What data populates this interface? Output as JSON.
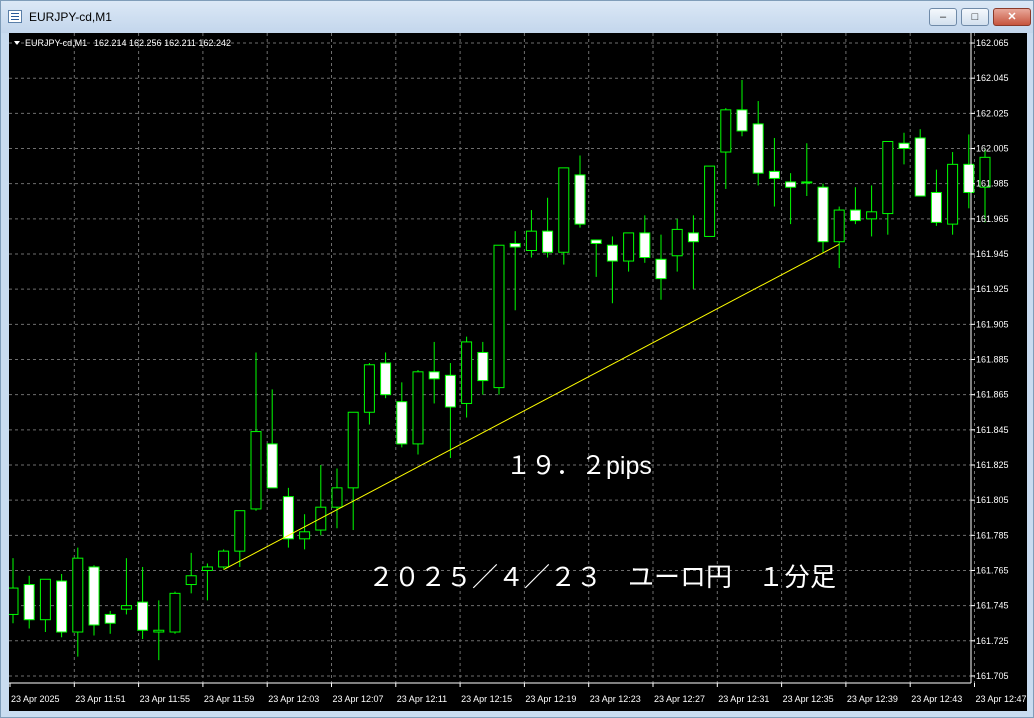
{
  "window": {
    "title": "EURJPY-cd,M1"
  },
  "controls": {
    "minimize": "–",
    "maximize": "□",
    "close": "✕"
  },
  "chart_header": {
    "symbol": "EURJPY-cd,M1",
    "ohlc": "162.214 162.256 162.211 162.242"
  },
  "annotations": {
    "pips": "１９．２pips",
    "caption": "２０２５／４／２３　ユーロ円　１分足"
  },
  "colors": {
    "background": "#000000",
    "grid": "#6e6e6e",
    "bull_body": "#000000",
    "bear_body": "#ffffff",
    "wick": "#00ff00",
    "trendline": "#ffff00",
    "text": "#ffffff"
  },
  "chart_data": {
    "type": "candlestick",
    "y_ticks": [
      "162.065",
      "162.045",
      "162.025",
      "162.005",
      "161.985",
      "161.965",
      "161.945",
      "161.925",
      "161.905",
      "161.885",
      "161.865",
      "161.845",
      "161.825",
      "161.805",
      "161.785",
      "161.765",
      "161.745",
      "161.725",
      "161.705"
    ],
    "ylim": [
      161.701,
      162.069
    ],
    "x_ticks": [
      "23 Apr 2025",
      "23 Apr 11:51",
      "23 Apr 11:55",
      "23 Apr 11:59",
      "23 Apr 12:03",
      "23 Apr 12:07",
      "23 Apr 12:11",
      "23 Apr 12:15",
      "23 Apr 12:19",
      "23 Apr 12:23",
      "23 Apr 12:27",
      "23 Apr 12:31",
      "23 Apr 12:35",
      "23 Apr 12:39",
      "23 Apr 12:43",
      "23 Apr 12:47"
    ],
    "grid": true,
    "candles": [
      {
        "o": 161.74,
        "h": 161.772,
        "l": 161.735,
        "c": 161.755
      },
      {
        "o": 161.757,
        "h": 161.762,
        "l": 161.732,
        "c": 161.737
      },
      {
        "o": 161.737,
        "h": 161.76,
        "l": 161.73,
        "c": 161.76
      },
      {
        "o": 161.759,
        "h": 161.763,
        "l": 161.727,
        "c": 161.73
      },
      {
        "o": 161.73,
        "h": 161.778,
        "l": 161.716,
        "c": 161.772
      },
      {
        "o": 161.767,
        "h": 161.768,
        "l": 161.728,
        "c": 161.734
      },
      {
        "o": 161.74,
        "h": 161.742,
        "l": 161.729,
        "c": 161.735
      },
      {
        "o": 161.743,
        "h": 161.772,
        "l": 161.74,
        "c": 161.745
      },
      {
        "o": 161.747,
        "h": 161.767,
        "l": 161.726,
        "c": 161.731
      },
      {
        "o": 161.73,
        "h": 161.748,
        "l": 161.714,
        "c": 161.731
      },
      {
        "o": 161.73,
        "h": 161.753,
        "l": 161.729,
        "c": 161.752
      },
      {
        "o": 161.757,
        "h": 161.775,
        "l": 161.752,
        "c": 161.762
      },
      {
        "o": 161.765,
        "h": 161.769,
        "l": 161.748,
        "c": 161.767
      },
      {
        "o": 161.767,
        "h": 161.777,
        "l": 161.766,
        "c": 161.776
      },
      {
        "o": 161.776,
        "h": 161.799,
        "l": 161.767,
        "c": 161.799
      },
      {
        "o": 161.8,
        "h": 161.889,
        "l": 161.799,
        "c": 161.844
      },
      {
        "o": 161.837,
        "h": 161.868,
        "l": 161.812,
        "c": 161.812
      },
      {
        "o": 161.807,
        "h": 161.812,
        "l": 161.778,
        "c": 161.783
      },
      {
        "o": 161.783,
        "h": 161.797,
        "l": 161.777,
        "c": 161.787
      },
      {
        "o": 161.788,
        "h": 161.825,
        "l": 161.785,
        "c": 161.801
      },
      {
        "o": 161.801,
        "h": 161.823,
        "l": 161.789,
        "c": 161.812
      },
      {
        "o": 161.812,
        "h": 161.85,
        "l": 161.788,
        "c": 161.855
      },
      {
        "o": 161.855,
        "h": 161.883,
        "l": 161.848,
        "c": 161.882
      },
      {
        "o": 161.883,
        "h": 161.889,
        "l": 161.863,
        "c": 161.865
      },
      {
        "o": 161.861,
        "h": 161.872,
        "l": 161.835,
        "c": 161.837
      },
      {
        "o": 161.837,
        "h": 161.879,
        "l": 161.831,
        "c": 161.878
      },
      {
        "o": 161.878,
        "h": 161.895,
        "l": 161.86,
        "c": 161.874
      },
      {
        "o": 161.876,
        "h": 161.883,
        "l": 161.829,
        "c": 161.858
      },
      {
        "o": 161.86,
        "h": 161.898,
        "l": 161.852,
        "c": 161.895
      },
      {
        "o": 161.889,
        "h": 161.895,
        "l": 161.865,
        "c": 161.873
      },
      {
        "o": 161.869,
        "h": 161.95,
        "l": 161.865,
        "c": 161.95
      },
      {
        "o": 161.951,
        "h": 161.958,
        "l": 161.913,
        "c": 161.949
      },
      {
        "o": 161.947,
        "h": 161.97,
        "l": 161.943,
        "c": 161.958
      },
      {
        "o": 161.958,
        "h": 161.977,
        "l": 161.943,
        "c": 161.946
      },
      {
        "o": 161.946,
        "h": 161.993,
        "l": 161.939,
        "c": 161.994
      },
      {
        "o": 161.99,
        "h": 162.001,
        "l": 161.96,
        "c": 161.962
      },
      {
        "o": 161.953,
        "h": 161.953,
        "l": 161.932,
        "c": 161.951
      },
      {
        "o": 161.95,
        "h": 161.955,
        "l": 161.917,
        "c": 161.941
      },
      {
        "o": 161.941,
        "h": 161.956,
        "l": 161.935,
        "c": 161.957
      },
      {
        "o": 161.957,
        "h": 161.967,
        "l": 161.94,
        "c": 161.943
      },
      {
        "o": 161.942,
        "h": 161.956,
        "l": 161.919,
        "c": 161.931
      },
      {
        "o": 161.944,
        "h": 161.965,
        "l": 161.935,
        "c": 161.959
      },
      {
        "o": 161.957,
        "h": 161.967,
        "l": 161.925,
        "c": 161.952
      },
      {
        "o": 161.955,
        "h": 161.99,
        "l": 161.958,
        "c": 161.995
      },
      {
        "o": 162.003,
        "h": 162.028,
        "l": 161.982,
        "c": 162.027
      },
      {
        "o": 162.027,
        "h": 162.044,
        "l": 162.012,
        "c": 162.015
      },
      {
        "o": 162.019,
        "h": 162.032,
        "l": 161.984,
        "c": 161.991
      },
      {
        "o": 161.992,
        "h": 162.011,
        "l": 161.972,
        "c": 161.988
      },
      {
        "o": 161.986,
        "h": 161.991,
        "l": 161.962,
        "c": 161.983
      },
      {
        "o": 161.986,
        "h": 162.008,
        "l": 161.978,
        "c": 161.986
      },
      {
        "o": 161.983,
        "h": 161.985,
        "l": 161.946,
        "c": 161.952
      },
      {
        "o": 161.952,
        "h": 161.972,
        "l": 161.937,
        "c": 161.97
      },
      {
        "o": 161.97,
        "h": 161.983,
        "l": 161.962,
        "c": 161.964
      },
      {
        "o": 161.965,
        "h": 161.984,
        "l": 161.955,
        "c": 161.969
      },
      {
        "o": 161.968,
        "h": 162.008,
        "l": 161.956,
        "c": 162.009
      },
      {
        "o": 162.008,
        "h": 162.014,
        "l": 161.996,
        "c": 162.005
      },
      {
        "o": 162.011,
        "h": 162.016,
        "l": 161.978,
        "c": 161.978
      },
      {
        "o": 161.98,
        "h": 161.993,
        "l": 161.961,
        "c": 161.963
      },
      {
        "o": 161.962,
        "h": 162.003,
        "l": 161.956,
        "c": 161.996
      },
      {
        "o": 161.996,
        "h": 162.013,
        "l": 161.971,
        "c": 161.98
      },
      {
        "o": 161.983,
        "h": 162.005,
        "l": 161.963,
        "c": 162.0
      }
    ],
    "trendline": {
      "from_index": 13,
      "from_price": 161.7655,
      "to_index": 51,
      "to_price": 161.9505
    }
  }
}
